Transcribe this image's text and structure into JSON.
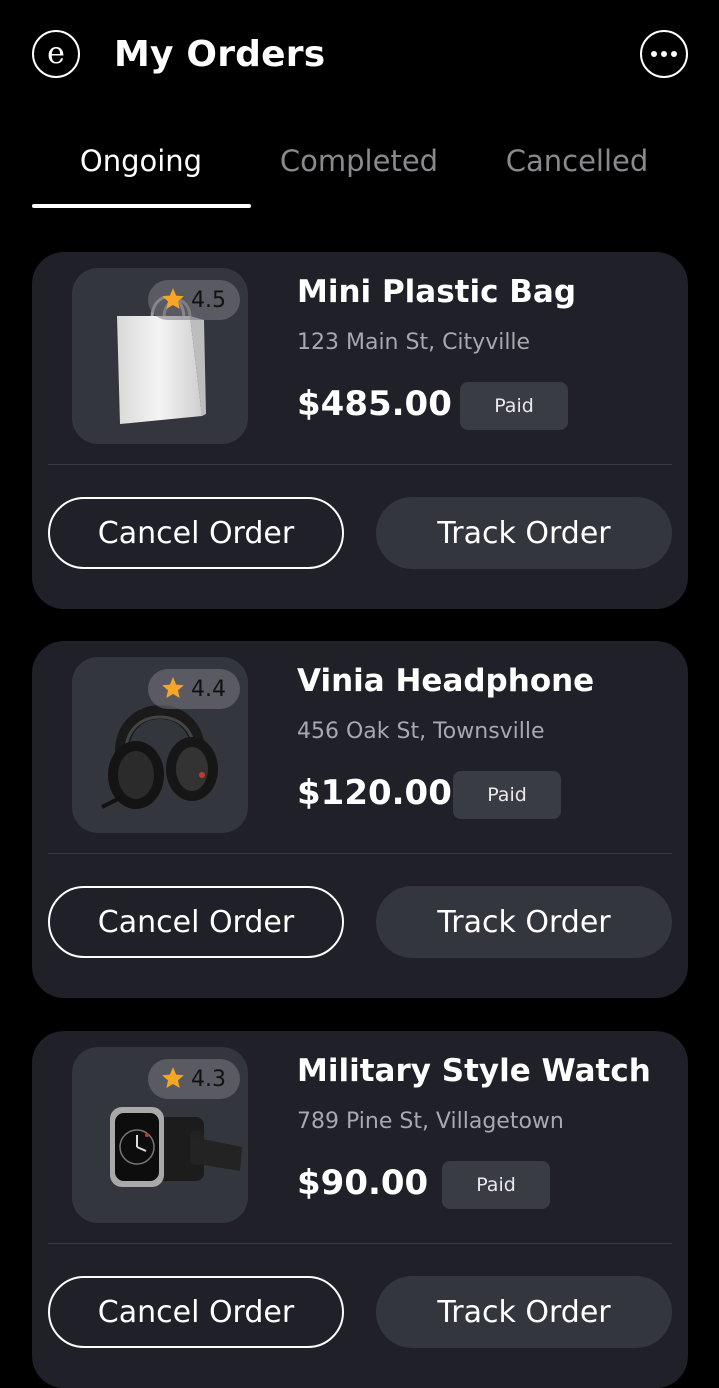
{
  "header": {
    "logo_letter": "e",
    "title": "My Orders"
  },
  "tabs": [
    {
      "label": "Ongoing",
      "active": true
    },
    {
      "label": "Completed",
      "active": false
    },
    {
      "label": "Cancelled",
      "active": false
    }
  ],
  "orders": [
    {
      "name": "Mini Plastic Bag",
      "address": "123 Main St, Cityville",
      "price": "$485.00",
      "status": "Paid",
      "rating": "4.5",
      "icon": "shopping-bag",
      "cancel_label": "Cancel Order",
      "track_label": "Track Order"
    },
    {
      "name": "Vinia Headphone",
      "address": "456 Oak St, Townsville",
      "price": "$120.00",
      "status": "Paid",
      "rating": "4.4",
      "icon": "headphones",
      "cancel_label": "Cancel Order",
      "track_label": "Track Order"
    },
    {
      "name": "Military Style Watch",
      "address": "789 Pine St, Villagetown",
      "price": "$90.00",
      "status": "Paid",
      "rating": "4.3",
      "icon": "smartwatch",
      "cancel_label": "Cancel Order",
      "track_label": "Track Order"
    }
  ],
  "colors": {
    "background": "#000000",
    "card": "#1f2028",
    "thumb": "#34363e",
    "star": "#f5a623",
    "muted_text": "#a8a8ae"
  }
}
